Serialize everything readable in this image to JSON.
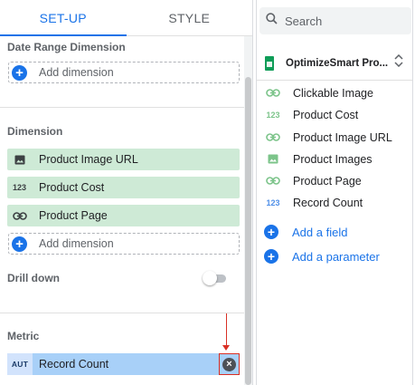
{
  "tabs": [
    {
      "label": "SET-UP",
      "active": true
    },
    {
      "label": "STYLE",
      "active": false
    }
  ],
  "setup": {
    "date_range": {
      "label": "Date Range Dimension",
      "add_label": "Add dimension"
    },
    "dimension": {
      "label": "Dimension",
      "chips": [
        {
          "icon": "image-icon",
          "label": "Product Image URL"
        },
        {
          "icon": "number-icon",
          "icon_text": "123",
          "label": "Product Cost"
        },
        {
          "icon": "link-icon",
          "label": "Product Page"
        }
      ],
      "add_label": "Add dimension"
    },
    "drill_down": {
      "label": "Drill down",
      "enabled": false
    },
    "metric": {
      "label": "Metric",
      "chips": [
        {
          "icon_text": "AUT",
          "label": "Record Count"
        }
      ]
    }
  },
  "search": {
    "placeholder": "Search"
  },
  "data_source": {
    "icon": "sheets-icon",
    "name": "OptimizeSmart Pro..."
  },
  "fields": [
    {
      "icon": "link-icon",
      "type": "dimension",
      "label": "Clickable Image"
    },
    {
      "icon": "number-icon",
      "icon_text": "123",
      "type": "dimension",
      "label": "Product Cost"
    },
    {
      "icon": "link-icon",
      "type": "dimension",
      "label": "Product Image URL"
    },
    {
      "icon": "image-icon",
      "type": "dimension",
      "label": "Product Images"
    },
    {
      "icon": "link-icon",
      "type": "dimension",
      "label": "Product Page"
    },
    {
      "icon": "number-icon",
      "icon_text": "123",
      "type": "metric",
      "label": "Record Count"
    }
  ],
  "actions": {
    "add_field": "Add a field",
    "add_parameter": "Add a parameter"
  },
  "colors": {
    "accent": "#1a73e8",
    "dimension_chip": "#ceead6",
    "metric_chip": "#a8d0f8",
    "annotation_red": "#d93025"
  }
}
